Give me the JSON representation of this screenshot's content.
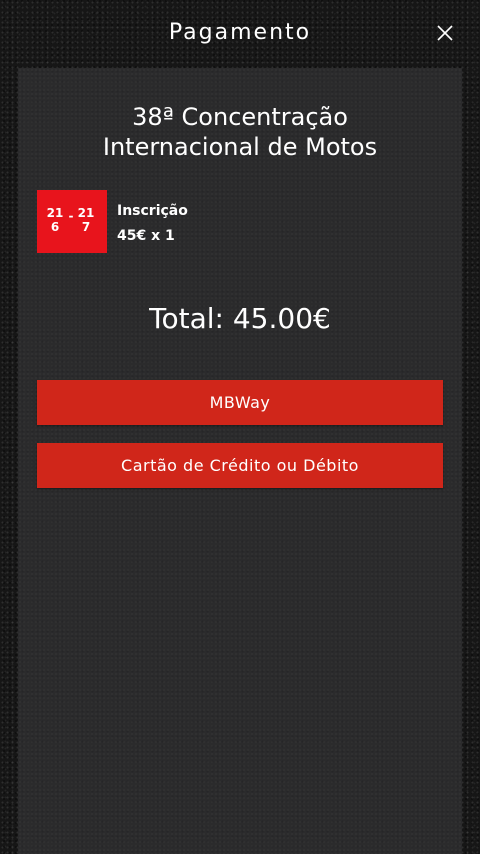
{
  "header": {
    "title": "Pagamento",
    "close_icon": "close-icon"
  },
  "event": {
    "title_line1": "38ª Concentração",
    "title_line2": "Internacional de Motos",
    "date_badge": {
      "start_day": "21",
      "start_month": "6",
      "separator": "-",
      "end_day": "21",
      "end_month": "7",
      "color": "#e8141c"
    }
  },
  "item": {
    "name": "Inscrição",
    "price_qty": "45€ x 1"
  },
  "total": "Total: 45.00€",
  "payment_methods": {
    "mbway_label": "MBWay",
    "card_label": "Cartão de Crédito ou Débito",
    "button_color": "#d0261a"
  }
}
